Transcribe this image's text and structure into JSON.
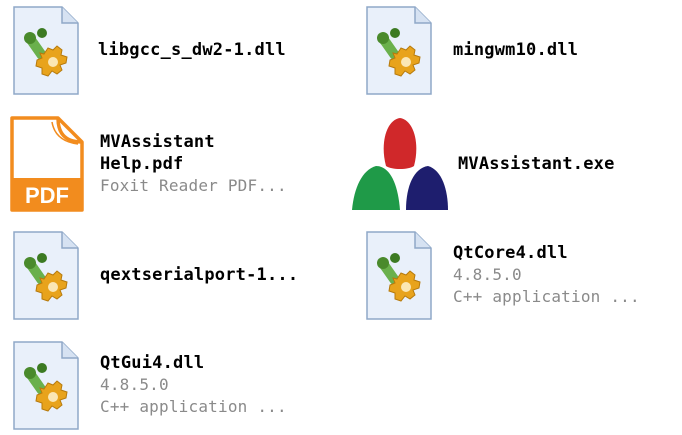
{
  "colors": {
    "background": "#ffffff",
    "name_text": "#000000",
    "meta_text": "#8a8a8a",
    "pdf_orange": "#f28c1e",
    "mv_red": "#d0282a",
    "mv_green": "#1f9a48",
    "mv_navy": "#1e1e6e"
  },
  "files": [
    {
      "icon": "dll-gear-icon",
      "name_lines": [
        "libgcc_s_dw2-1.dll"
      ],
      "meta_lines": []
    },
    {
      "icon": "dll-gear-icon",
      "name_lines": [
        "mingwm10.dll"
      ],
      "meta_lines": []
    },
    {
      "icon": "pdf-icon",
      "icon_text": "PDF",
      "name_lines": [
        "MVAssistant",
        "Help.pdf"
      ],
      "meta_lines": [
        "Foxit Reader PDF..."
      ]
    },
    {
      "icon": "mvassistant-app-icon",
      "name_lines": [
        "MVAssistant.exe"
      ],
      "meta_lines": []
    },
    {
      "icon": "dll-gear-icon",
      "name_lines": [
        "qextserialport-1..."
      ],
      "meta_lines": []
    },
    {
      "icon": "dll-gear-icon",
      "name_lines": [
        "QtCore4.dll"
      ],
      "meta_lines": [
        "4.8.5.0",
        "C++ application ..."
      ]
    },
    {
      "icon": "dll-gear-icon",
      "name_lines": [
        "QtGui4.dll"
      ],
      "meta_lines": [
        "4.8.5.0",
        "C++ application ..."
      ]
    }
  ]
}
